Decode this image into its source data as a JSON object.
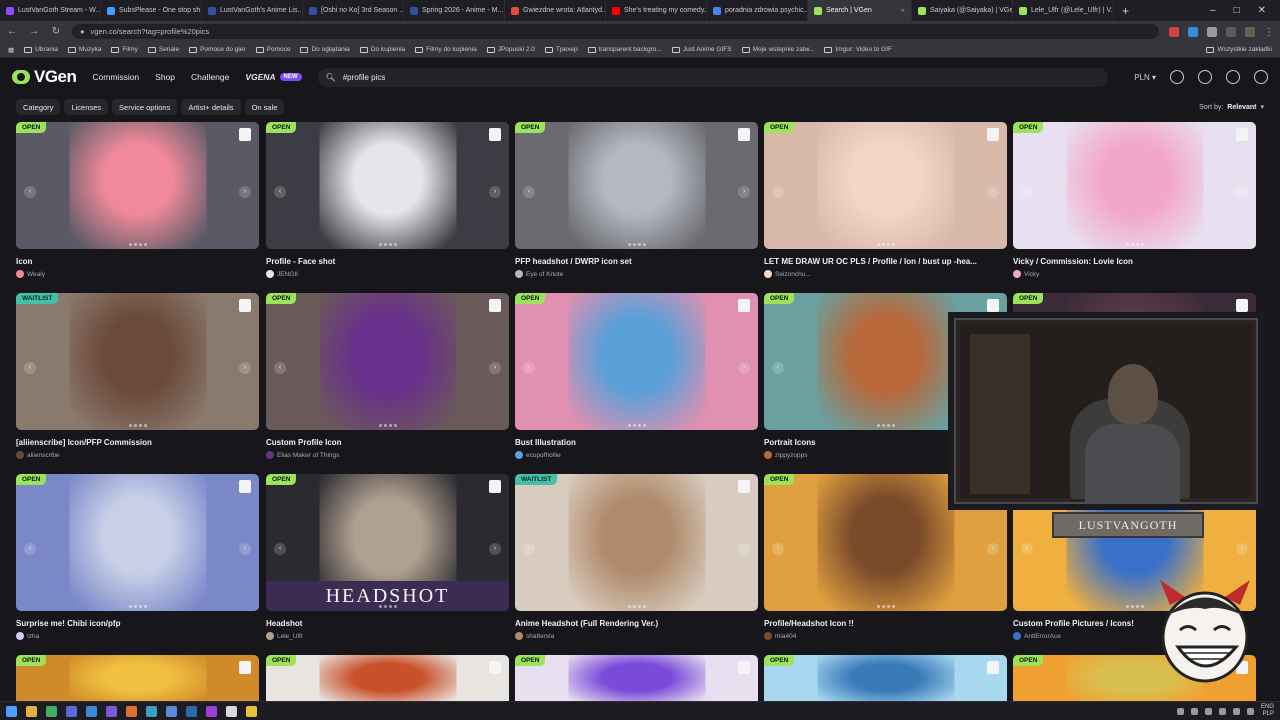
{
  "browser": {
    "tabs": [
      {
        "title": "LustVanGoth Stream - W...",
        "color": "#9146ff",
        "active": false
      },
      {
        "title": "SubsPlease - One stop sh...",
        "color": "#3aa0ff",
        "active": false
      },
      {
        "title": "LustVanGoth's Anime Lis...",
        "color": "#2e51a2",
        "active": false
      },
      {
        "title": "[Oshi no Ko] 3rd Season ...",
        "color": "#2e51a2",
        "active": false
      },
      {
        "title": "Spring 2026 - Anime - M...",
        "color": "#2e51a2",
        "active": false
      },
      {
        "title": "Gwiezdne wrota: Atlantyd...",
        "color": "#e04a3f",
        "active": false
      },
      {
        "title": "She's treating my comedy...",
        "color": "#ff0000",
        "active": false
      },
      {
        "title": "poradnia zdrowia psychic...",
        "color": "#4285f4",
        "active": false
      },
      {
        "title": "Search | VGen",
        "color": "#9be45a",
        "active": true
      },
      {
        "title": "Saiyaka (@Saiyaka) | VGen",
        "color": "#9be45a",
        "active": false
      },
      {
        "title": "Lele_Ulfr (@Lele_Ulfr) | V...",
        "color": "#9be45a",
        "active": false
      }
    ],
    "url": "vgen.co/search?tag=profile%20pics",
    "bookmarks": [
      "Ubrania",
      "Muzyka",
      "Filmy",
      "Seriale",
      "Pomoce do gier",
      "Pomoce",
      "Do oglądania",
      "Do kupienia",
      "Filmy do kupienia",
      "JPopuski 2.0",
      "Tpexep",
      "transparent backgro...",
      "Just Anime GIFS",
      "Moje wstepnie zatw...",
      "Imgur: Video to GIF"
    ],
    "all_bookmarks": "Wszystkie zakładki"
  },
  "header": {
    "logo": "VGen",
    "nav": [
      "Commission",
      "Shop",
      "Challenge"
    ],
    "vgna": "VGENA",
    "new_badge": "NEW",
    "search_value": "#profile pics",
    "currency": "PLN"
  },
  "filters": {
    "buttons": [
      "Category",
      "Licenses",
      "Service options",
      "Artist+ details",
      "On sale"
    ],
    "sort_label": "Sort by:",
    "sort_value": "Relevant"
  },
  "cards": [
    {
      "status": "OPEN",
      "title": "Icon",
      "artist": "Wealy",
      "colors": [
        "#5a5a66",
        "#f08a9a"
      ]
    },
    {
      "status": "OPEN",
      "title": "Profile - Face shot",
      "artist": "JENGII",
      "colors": [
        "#3c3c44",
        "#e6e6ea"
      ]
    },
    {
      "status": "OPEN",
      "title": "PFP headshot / DWRP icon set",
      "artist": "Eye of Knute",
      "colors": [
        "#6a6a70",
        "#b4b8c0"
      ]
    },
    {
      "status": "OPEN",
      "title": "LET ME DRAW UR OC PLS / Profile / Ion / bust up -hea...",
      "artist": "Seizonchu...",
      "colors": [
        "#d8b8a8",
        "#f3d6c8"
      ]
    },
    {
      "status": "OPEN",
      "title": "Vicky / Commission: Lovie Icon",
      "artist": "Vicky",
      "colors": [
        "#e8e0f0",
        "#f2a6c8"
      ]
    },
    {
      "status": "WAITLIST",
      "title": "[aliienscribe] Icon/PFP Commission",
      "artist": "aliienscribe",
      "colors": [
        "#8a7a6e",
        "#6b4a3a"
      ]
    },
    {
      "status": "OPEN",
      "title": "Custom Profile Icon",
      "artist": "Elias Maker of Things",
      "colors": [
        "#6a5a5a",
        "#6a2f8a"
      ]
    },
    {
      "status": "OPEN",
      "title": "Bust Illustration",
      "artist": "ecupofhollie",
      "colors": [
        "#e090b0",
        "#5aa0d8"
      ]
    },
    {
      "status": "OPEN",
      "title": "Portrait Icons",
      "artist": "zippyzopps",
      "colors": [
        "#6aa0a0",
        "#b8683a"
      ]
    },
    {
      "status": "OPEN",
      "title": "",
      "artist": "",
      "colors": [
        "#3a2a3a",
        "#5a3a4a"
      ]
    },
    {
      "status": "OPEN",
      "title": "Surprise me! Chibi icon/pfp",
      "artist": "Izha",
      "colors": [
        "#7a88c8",
        "#c8d0e8"
      ]
    },
    {
      "status": "OPEN",
      "title": "Headshot",
      "artist": "Lele_Ulfr",
      "colors": [
        "#2a2a30",
        "#b0a090"
      ],
      "band": "HEADSHOT"
    },
    {
      "status": "WAITLIST",
      "title": "Anime Headshot (Full Rendering Ver.)",
      "artist": "shatterxla",
      "colors": [
        "#d8ccc0",
        "#b08a6a"
      ]
    },
    {
      "status": "OPEN",
      "title": "Profile/Headshot Icon !!",
      "artist": "mia404",
      "colors": [
        "#e0a040",
        "#7a4a2a"
      ]
    },
    {
      "status": "OPEN",
      "title": "Custom Profile Pictures / Icons!",
      "artist": "AntiErrorAce",
      "colors": [
        "#f0b040",
        "#3a70c8"
      ]
    },
    {
      "status": "OPEN",
      "title": "",
      "artist": "",
      "colors": [
        "#d08a2a",
        "#f0c040"
      ]
    },
    {
      "status": "OPEN",
      "title": "",
      "artist": "",
      "colors": [
        "#e8e4e0",
        "#c8502a"
      ]
    },
    {
      "status": "OPEN",
      "title": "",
      "artist": "",
      "colors": [
        "#e8e0f0",
        "#7a4ad8"
      ]
    },
    {
      "status": "OPEN",
      "title": "",
      "artist": "",
      "colors": [
        "#a8d8f0",
        "#3a7ab8"
      ]
    },
    {
      "status": "OPEN",
      "title": "",
      "artist": "",
      "colors": [
        "#f0a030",
        "#d8c050"
      ]
    }
  ],
  "overlay": {
    "nameplate": "LUSTVANGOTH"
  },
  "taskbar": {
    "lang_top": "ENG",
    "lang_bottom": "PLP"
  }
}
